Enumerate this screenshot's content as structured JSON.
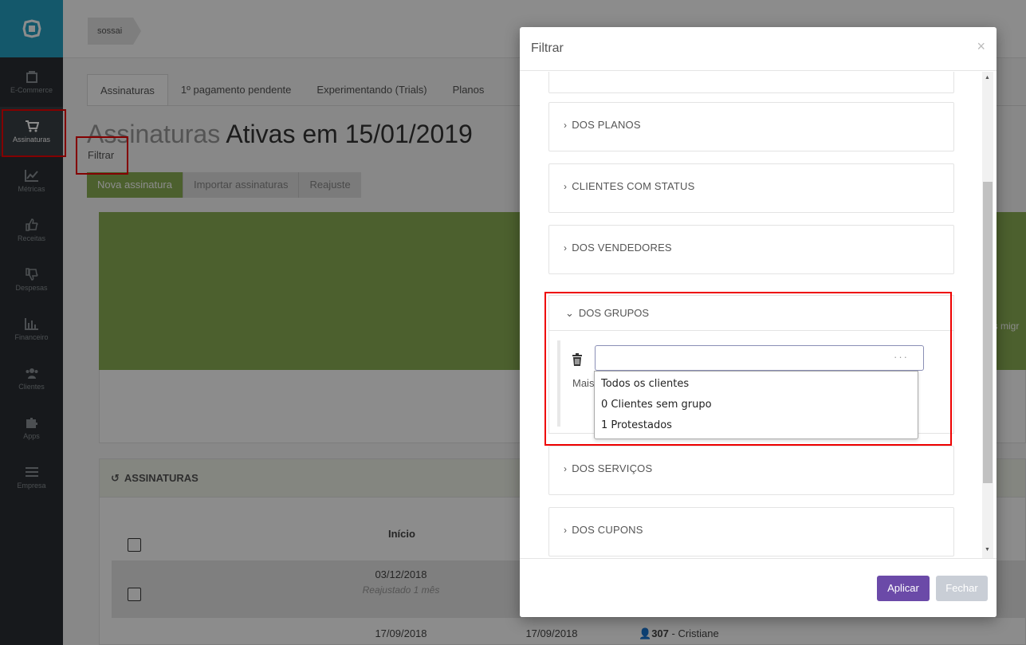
{
  "sidebar": {
    "items": [
      {
        "label": "E-Commerce",
        "icon": "shopping-bag-icon"
      },
      {
        "label": "Assinaturas",
        "icon": "cart-icon"
      },
      {
        "label": "Métricas",
        "icon": "chart-line-icon"
      },
      {
        "label": "Receitas",
        "icon": "thumbs-up-icon"
      },
      {
        "label": "Despesas",
        "icon": "thumbs-down-icon"
      },
      {
        "label": "Financeiro",
        "icon": "bar-chart-icon"
      },
      {
        "label": "Clientes",
        "icon": "users-icon"
      },
      {
        "label": "Apps",
        "icon": "puzzle-icon"
      },
      {
        "label": "Empresa",
        "icon": "menu-icon"
      }
    ]
  },
  "topbar": {
    "breadcrumb": "sossai"
  },
  "tabs": [
    "Assinaturas",
    "1º pagamento pendente",
    "Experimentando (Trials)",
    "Planos"
  ],
  "page": {
    "title_light": "Assinaturas",
    "title_dark": "Ativas em 15/01/2019",
    "filter_link": "Filtrar",
    "buttons": [
      "Nova assinatura",
      "Importar assinaturas",
      "Reajuste"
    ],
    "panel_text": "as migr"
  },
  "list": {
    "header": "ASSINATURAS",
    "column_inicio": "Início",
    "row1": {
      "date": "03/12/2018",
      "note": "Reajustado 1 mês"
    },
    "row2": {
      "date": "17/09/2018",
      "date2": "17/09/2018",
      "client_num": "307",
      "client_name": "- Cristiane"
    }
  },
  "modal": {
    "title": "Filtrar",
    "close": "×",
    "sections": {
      "planos": "DOS PLANOS",
      "status": "CLIENTES COM STATUS",
      "vendedores": "DOS VENDEDORES",
      "grupos": "DOS GRUPOS",
      "servicos": "DOS SERVIÇOS",
      "cupons": "DOS CUPONS"
    },
    "group_select": {
      "value": "",
      "dots": "···",
      "options": [
        "Todos os clientes",
        "0 Clientes sem grupo",
        "1 Protestados"
      ]
    },
    "mais_label": "Mais",
    "apply": "Aplicar",
    "close_btn": "Fechar"
  },
  "colors": {
    "accent_logo": "#25a0c4",
    "green": "#8bb054",
    "apply": "#6b4aa8",
    "highlight": "#e00000"
  }
}
